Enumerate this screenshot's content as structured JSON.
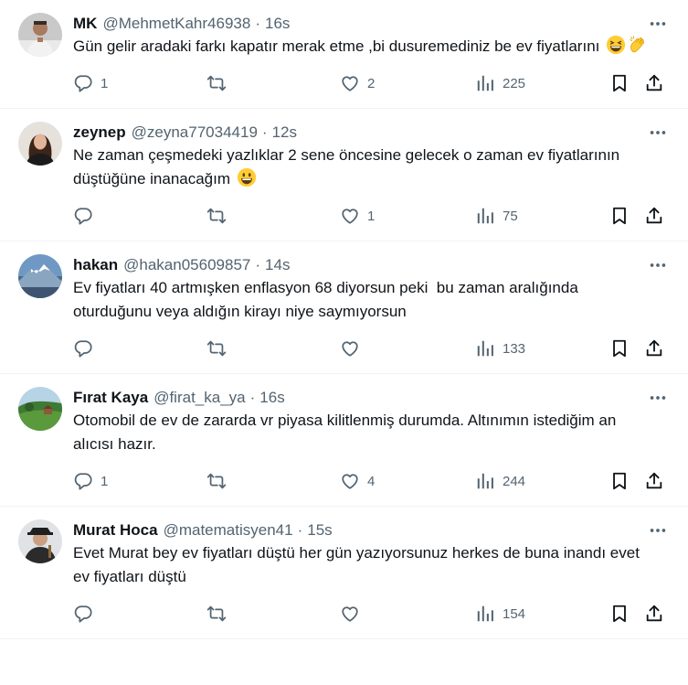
{
  "tweets": [
    {
      "name": "MK",
      "handle": "@MehmetKahr46938",
      "time": "16s",
      "text": "Gün gelir aradaki farkı kapatır merak etme ,bi dusuremediniz be ev fiyatlarını ",
      "emojis": [
        "grinning-squinting-face",
        "clapping-hands"
      ],
      "replies": "1",
      "retweets": "",
      "likes": "2",
      "views": "225",
      "avatar": "person-icon"
    },
    {
      "name": "zeynep",
      "handle": "@zeyna77034419",
      "time": "12s",
      "text": "Ne zaman çeşmedeki yazlıklar 2 sene öncesine gelecek o zaman ev fiyatlarının düştüğüne inanacağım ",
      "emojis": [
        "grinning-face"
      ],
      "replies": "",
      "retweets": "",
      "likes": "1",
      "views": "75",
      "avatar": "person-icon"
    },
    {
      "name": "hakan",
      "handle": "@hakan05609857",
      "time": "14s",
      "text": "Ev fiyatları 40 artmışken enflasyon 68 diyorsun peki  bu zaman aralığında oturduğunu veya aldığın kirayı niye saymıyorsun",
      "emojis": [],
      "replies": "",
      "retweets": "",
      "likes": "",
      "views": "133",
      "avatar": "mountain-icon"
    },
    {
      "name": "Fırat Kaya",
      "handle": "@firat_ka_ya",
      "time": "16s",
      "text": "Otomobil de ev de zararda vr piyasa kilitlenmiş durumda. Altınımın istediğim an alıcısı hazır.",
      "emojis": [],
      "replies": "1",
      "retweets": "",
      "likes": "4",
      "views": "244",
      "avatar": "landscape-icon"
    },
    {
      "name": "Murat Hoca",
      "handle": "@matematisyen41",
      "time": "15s",
      "text": "Evet Murat bey ev fiyatları düştü her gün yazıyorsunuz herkes de buna inandı evet ev fiyatları düştü",
      "emojis": [],
      "replies": "",
      "retweets": "",
      "likes": "",
      "views": "154",
      "avatar": "person-icon"
    }
  ],
  "colors": {
    "text": "#0f1419",
    "muted": "#536471",
    "border": "#eff3f4"
  },
  "icons": {
    "more": "more-dots-icon",
    "reply": "reply-icon",
    "retweet": "retweet-icon",
    "like": "heart-icon",
    "views": "views-chart-icon",
    "bookmark": "bookmark-icon",
    "share": "share-icon"
  }
}
